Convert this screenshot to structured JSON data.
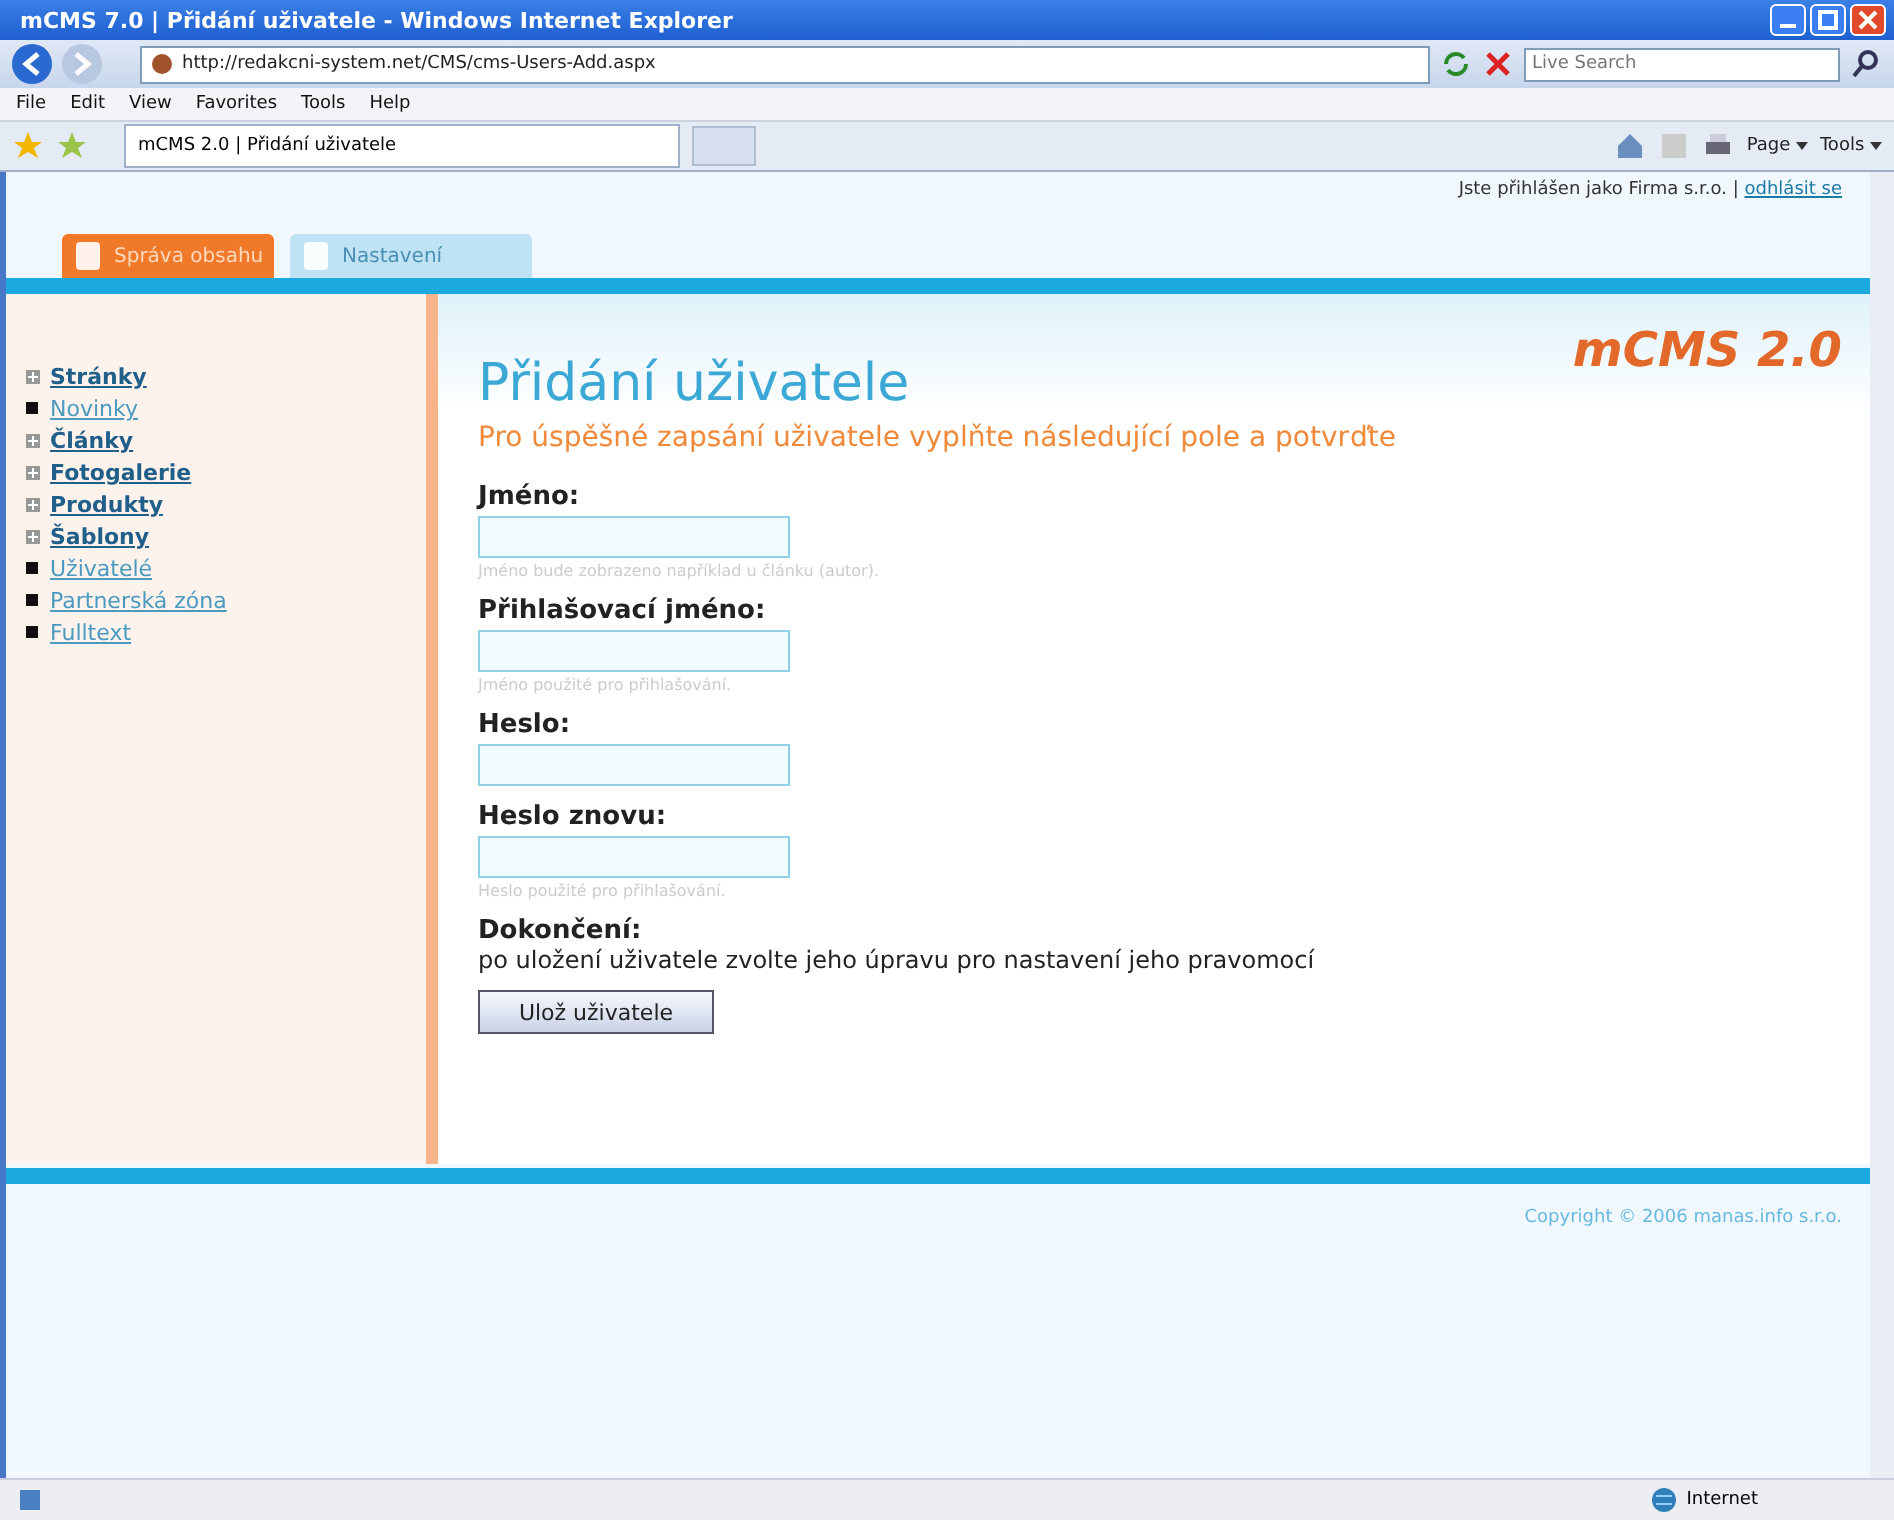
{
  "window": {
    "title": "mCMS 7.0 | Přidání uživatele - Windows Internet Explorer"
  },
  "address_bar": {
    "url": "http://redakcni-system.net/CMS/cms-Users-Add.aspx",
    "search_placeholder": "Live Search"
  },
  "menu": [
    "File",
    "Edit",
    "View",
    "Favorites",
    "Tools",
    "Help"
  ],
  "browser_tab": {
    "title": "mCMS 2.0 | Přidání uživatele"
  },
  "command_bar": [
    "Page",
    "Tools"
  ],
  "header": {
    "login_text": "Jste přihlášen jako Firma s.r.o. |",
    "logout": "odhlásit se",
    "tabs": [
      {
        "label": "Správa obsahu",
        "selected": true
      },
      {
        "label": "Nastavení",
        "selected": false
      }
    ]
  },
  "sidebar": {
    "items": [
      {
        "label": "Stránky",
        "kind": "group"
      },
      {
        "label": "Novinky",
        "kind": "link"
      },
      {
        "label": "Články",
        "kind": "group"
      },
      {
        "label": "Fotogalerie",
        "kind": "group"
      },
      {
        "label": "Produkty",
        "kind": "group"
      },
      {
        "label": "Šablony",
        "kind": "group"
      },
      {
        "label": "Uživatelé",
        "kind": "link"
      },
      {
        "label": "Partnerská zóna",
        "kind": "link"
      },
      {
        "label": "Fulltext",
        "kind": "link"
      }
    ]
  },
  "content": {
    "logo": "mCMS 2.0",
    "heading": "Přidání uživatele",
    "subheading": "Pro úspěšné zapsání uživatele vyplňte následující pole a potvrďte",
    "fields": [
      {
        "label": "Jméno:",
        "hint": "Jméno bude zobrazeno například u článku (autor)."
      },
      {
        "label": "Přihlašovací jméno:",
        "hint": "Jméno použité pro přihlašování."
      },
      {
        "label": "Heslo:"
      },
      {
        "label": "Heslo znovu:",
        "hint": "Heslo použité pro přihlašování."
      }
    ],
    "finish_label": "Dokončení:",
    "finish_text": "po uložení uživatele zvolte jeho úpravu pro nastavení jeho pravomocí",
    "save_button": "Ulož uživatele"
  },
  "footer": {
    "copyright": "Copyright © 2006 manas.info s.r.o."
  },
  "status_bar": {
    "zone": "Internet"
  }
}
